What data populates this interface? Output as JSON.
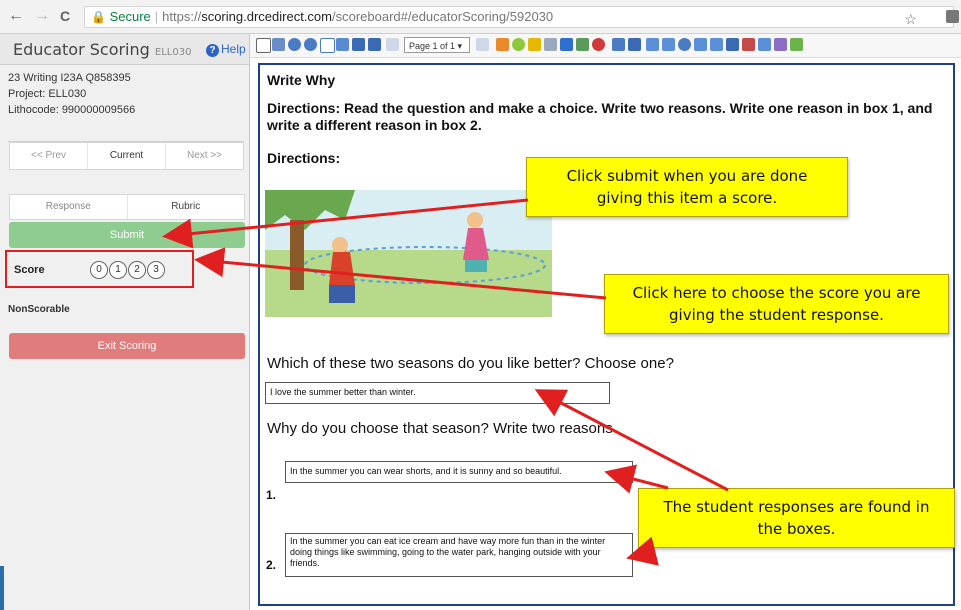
{
  "browser": {
    "nav_back": "←",
    "nav_forward": "→",
    "reload": "C",
    "secure_label": "Secure",
    "url_scheme": "https://",
    "url_host": "scoring.drcedirect.com",
    "url_path": "/scoreboard#/educatorScoring/592030",
    "star": "☆"
  },
  "sidebar": {
    "title": "Educator Scoring",
    "title_code": "ELL030",
    "help_label": "Help",
    "item_line": "23 Writing I23A Q858395",
    "project": "Project: ELL030",
    "lithocode": "Lithocode: 990000009566",
    "nav": {
      "prev": "<< Prev",
      "current": "Current",
      "next": "Next >>"
    },
    "tabs": {
      "response": "Response",
      "rubric": "Rubric"
    },
    "submit_label": "Submit",
    "score_label": "Score",
    "score_options": [
      "0",
      "1",
      "2",
      "3"
    ],
    "nonscorable_label": "NonScorable",
    "exit_label": "Exit Scoring"
  },
  "toolbar": {
    "page_select": "Page 1 of 1 ▾"
  },
  "document": {
    "title": "Write Why",
    "directions": "Directions: Read the question and make a choice. Write two reasons. Write one reason in box 1, and write a different reason in box 2.",
    "directions_label": "Directions:",
    "question1": "Which of these two seasons do you like better? Choose one?",
    "answer1": "I love the summer better than winter.",
    "question2": "Why do you choose that season? Write two reasons",
    "reason1_num": "1.",
    "reason1": "In the summer you can wear shorts, and it is sunny and so beautiful.",
    "reason2_num": "2.",
    "reason2": "In the summer you can eat ice cream and have way more fun than in the winter doing things like swimming, going to the water park, hanging outside with your friends."
  },
  "callouts": {
    "submit_note": "Click submit when you are done giving this item a score.",
    "score_note": "Click here to choose the score you are giving the student response.",
    "responses_note": "The student responses are found in the boxes."
  },
  "colors": {
    "submit": "#8fcc8f",
    "exit": "#e07c7c",
    "callout": "#ffff00",
    "arrow": "#e02020",
    "doc_border": "#1d3f8c"
  }
}
